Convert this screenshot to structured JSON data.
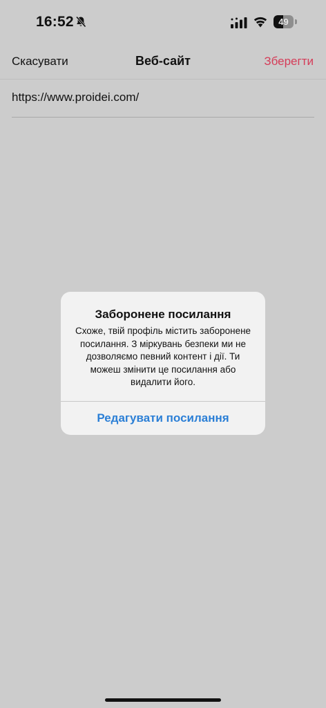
{
  "status_bar": {
    "time": "16:52",
    "battery_level": "49",
    "battery_fraction": 0.49,
    "icons": [
      "bell-slash-icon",
      "cellular-signal-icon",
      "wifi-icon",
      "battery-icon"
    ]
  },
  "nav": {
    "cancel_label": "Скасувати",
    "title": "Веб-сайт",
    "save_label": "Зберегти",
    "save_color": "#d53c58"
  },
  "form": {
    "website_value": "https://www.proidei.com/"
  },
  "alert": {
    "title": "Заборонене посилання",
    "message": "Схоже, твій профіль містить заборонене посилання. З міркувань безпеки ми не дозволяємо певний контент і дії. Ти можеш змінити це посилання або видалити його.",
    "action_label": "Редагувати посилання",
    "action_color": "#2b7fd6"
  },
  "colors": {
    "background": "#cccccc",
    "alert_background": "#f2f2f2"
  }
}
